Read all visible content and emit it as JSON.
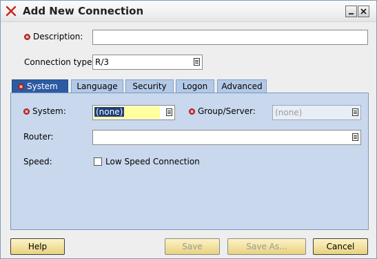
{
  "window": {
    "title": "Add New Connection"
  },
  "fields": {
    "description_label": "Description:",
    "description_value": "",
    "connection_type_label": "Connection type:",
    "connection_type_value": "R/3"
  },
  "tabs": [
    {
      "label": "System",
      "active": true
    },
    {
      "label": "Language",
      "active": false
    },
    {
      "label": "Security",
      "active": false
    },
    {
      "label": "Logon",
      "active": false
    },
    {
      "label": "Advanced",
      "active": false
    }
  ],
  "system_tab": {
    "system_label": "System:",
    "system_value": "(none)",
    "group_label": "Group/Server:",
    "group_value": "(none)",
    "router_label": "Router:",
    "router_value": "",
    "speed_label": "Speed:",
    "low_speed_label": "Low Speed Connection",
    "low_speed_checked": false
  },
  "buttons": {
    "help": "Help",
    "save": "Save",
    "save_as": "Save As...",
    "cancel": "Cancel"
  },
  "colors": {
    "active_tab": "#2c5ba2",
    "inactive_tab": "#b3c9e6",
    "panel": "#c9d8ed",
    "required_marker": "#cc2b2b",
    "button_fill": "#f0dc8e",
    "highlight_field": "#ffffa0"
  }
}
